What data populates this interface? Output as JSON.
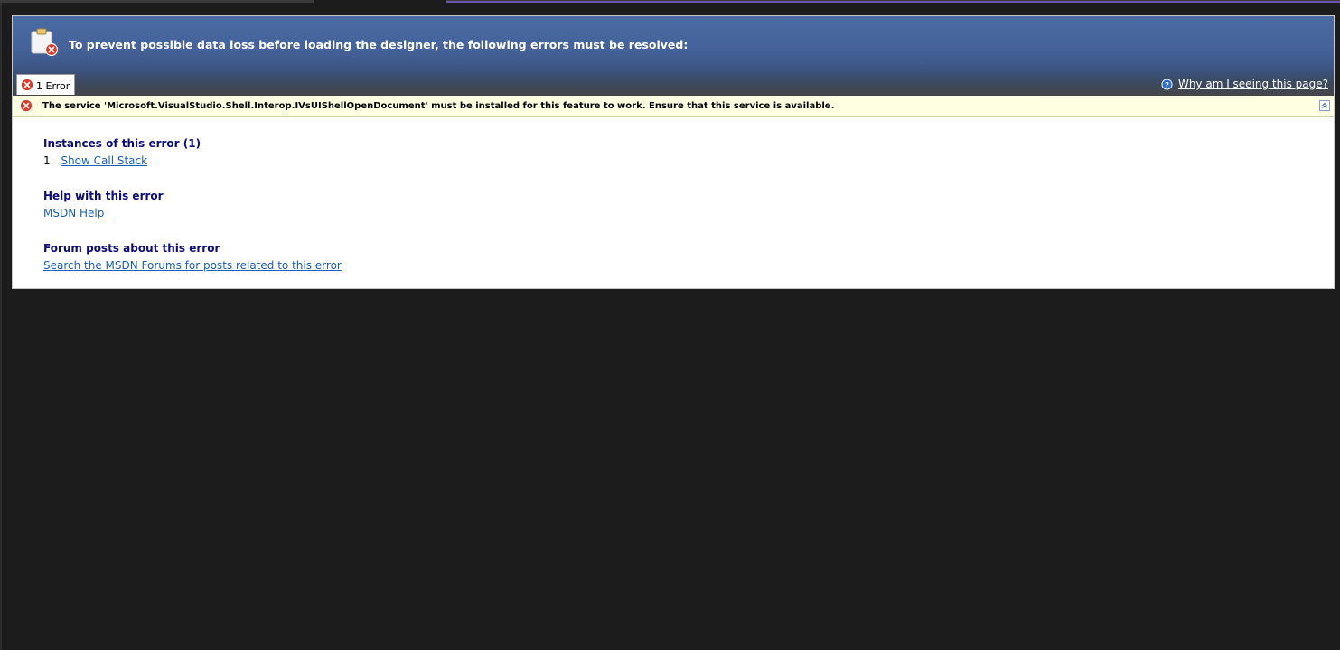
{
  "header": {
    "title": "To prevent possible data loss before loading the designer, the following errors must be resolved:",
    "icon": "clipboard-error-icon"
  },
  "tabs": [
    {
      "label": "1 Error",
      "icon": "error-icon"
    }
  ],
  "help_link": {
    "label": "Why am I seeing this page?",
    "icon": "help-icon"
  },
  "error_message": {
    "text": "The service 'Microsoft.VisualStudio.Shell.Interop.IVsUIShellOpenDocument' must be installed for this feature to work. Ensure that this service is available.",
    "icon": "error-icon"
  },
  "sections": {
    "instances": {
      "heading": "Instances of this error (1)",
      "items": [
        {
          "number": "1.",
          "label": "Show Call Stack"
        }
      ]
    },
    "help": {
      "heading": "Help with this error",
      "link": "MSDN Help"
    },
    "forum": {
      "heading": "Forum posts about this error",
      "link": "Search the MSDN Forums for posts related to this error"
    }
  },
  "colors": {
    "header_blue": "#4a6aa3",
    "error_bar_bg": "#ffffe1",
    "heading_text": "#0b0b7a",
    "link": "#1a5fb4",
    "background": "#1c1c1c"
  }
}
